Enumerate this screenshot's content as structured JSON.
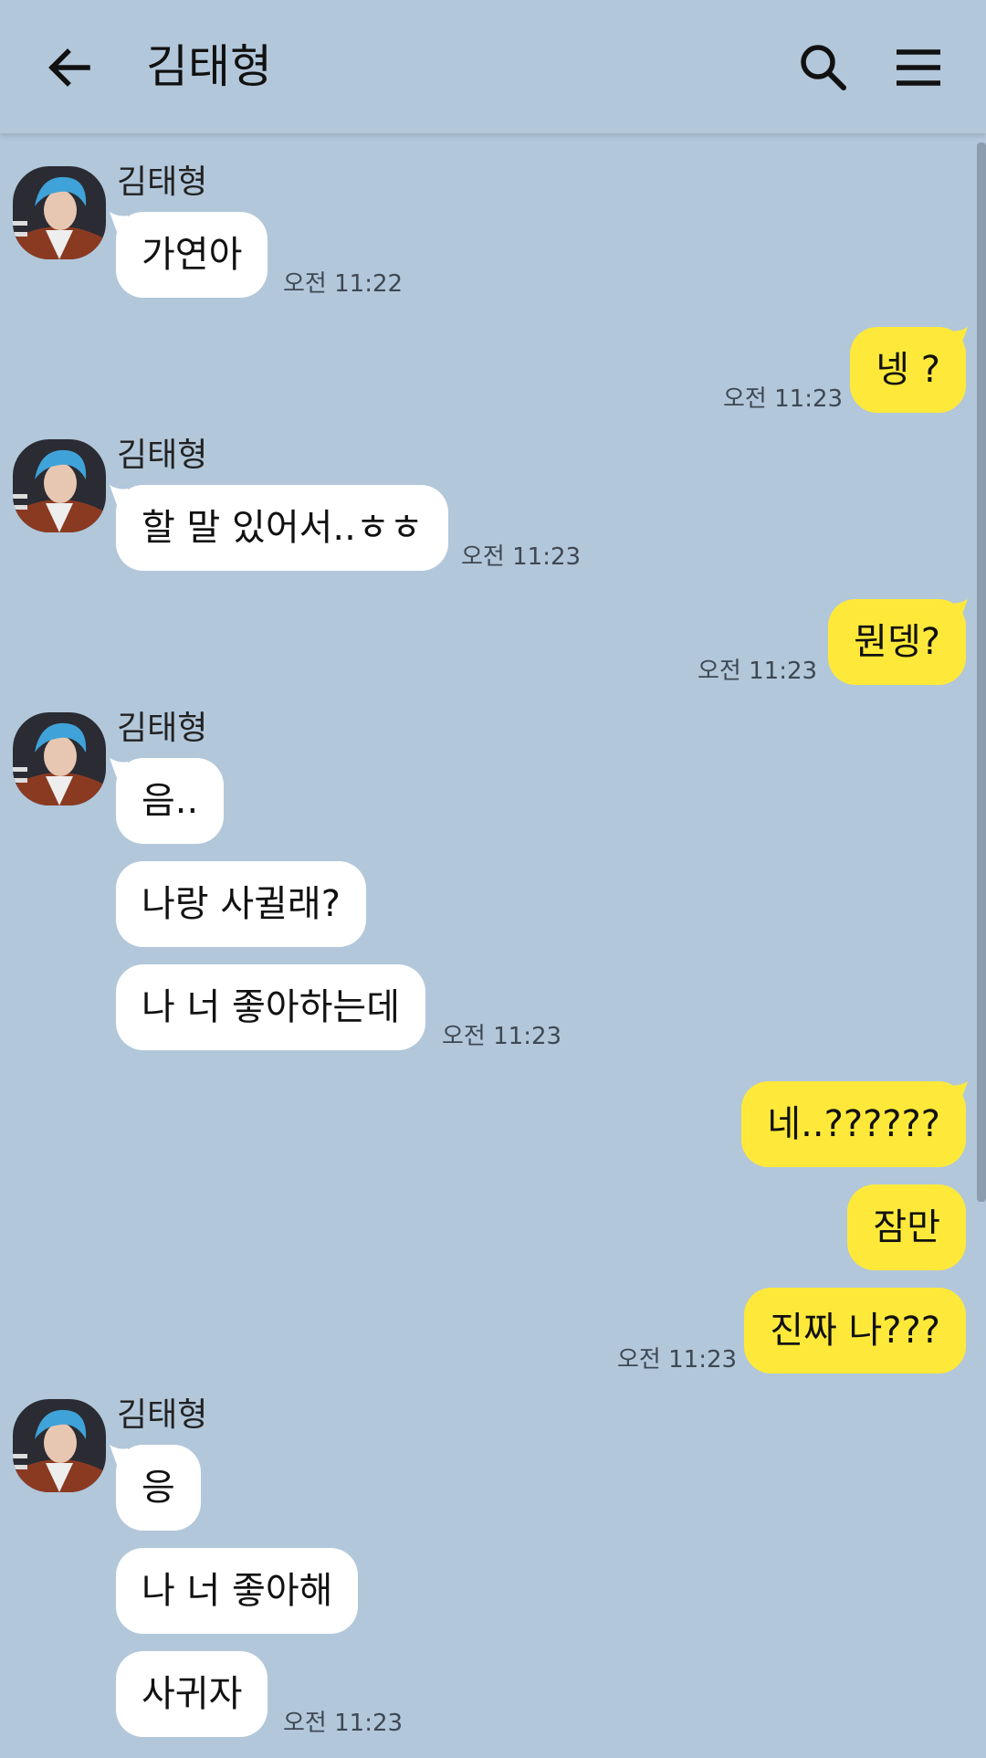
{
  "header": {
    "title": "김태형",
    "back_icon": "arrow-left-icon",
    "search_icon": "search-icon",
    "menu_icon": "hamburger-menu-icon"
  },
  "colors": {
    "background": "#b2c7da",
    "incoming_bubble": "#ffffff",
    "outgoing_bubble": "#fee93a"
  },
  "messages": [
    {
      "sender": "김태형",
      "text": "가연아",
      "time": "오전 11:22"
    },
    {
      "text": "넹 ?",
      "time": "오전 11:23"
    },
    {
      "sender": "김태형",
      "text": "할 말 있어서..ㅎㅎ",
      "time": "오전 11:23"
    },
    {
      "text": "뭔뎅?",
      "time": "오전 11:23"
    },
    {
      "sender": "김태형",
      "texts": [
        "음..",
        "나랑 사귈래?",
        "나 너 좋아하는데"
      ],
      "time": "오전 11:23"
    },
    {
      "texts": [
        "네..??????",
        "잠만",
        "진짜 나???"
      ],
      "time": "오전 11:23"
    },
    {
      "sender": "김태형",
      "texts": [
        "응",
        "나 너 좋아해",
        "사귀자"
      ],
      "time": "오전 11:23"
    }
  ]
}
